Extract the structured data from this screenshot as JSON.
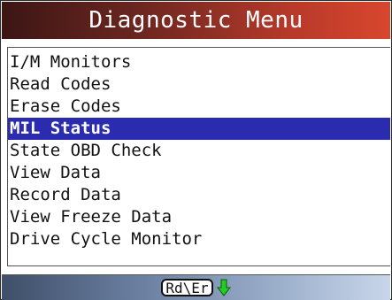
{
  "header": {
    "title": "Diagnostic Menu"
  },
  "menu": {
    "items": [
      {
        "label": "I/M Monitors",
        "selected": false
      },
      {
        "label": "Read Codes",
        "selected": false
      },
      {
        "label": "Erase Codes",
        "selected": false
      },
      {
        "label": "MIL Status",
        "selected": true
      },
      {
        "label": "State OBD Check",
        "selected": false
      },
      {
        "label": "View Data",
        "selected": false
      },
      {
        "label": "Record Data",
        "selected": false
      },
      {
        "label": "View Freeze Data",
        "selected": false
      },
      {
        "label": "Drive Cycle Monitor",
        "selected": false
      }
    ]
  },
  "footer": {
    "key_label": "Rd\\Er",
    "scroll_icon": "down-arrow-icon"
  },
  "colors": {
    "title_text": "#ffffff",
    "selection_background": "#2b2bb0",
    "selection_text": "#ffffff",
    "arrow_green": "#22cc22"
  }
}
